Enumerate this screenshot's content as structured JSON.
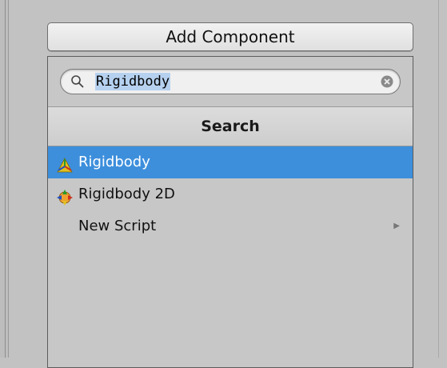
{
  "add_component": {
    "label": "Add Component"
  },
  "search": {
    "value": "Rigidbody"
  },
  "section": {
    "title": "Search"
  },
  "results": [
    {
      "label": "Rigidbody",
      "icon": "rigidbody-3d-icon",
      "selected": true
    },
    {
      "label": "Rigidbody 2D",
      "icon": "rigidbody-2d-icon",
      "selected": false
    },
    {
      "label": "New Script",
      "icon": "",
      "selected": false,
      "has_submenu": true
    }
  ],
  "colors": {
    "selection": "#3d8fdc",
    "text_selection": "#b6d1ef",
    "panel": "#c7c7c7"
  }
}
